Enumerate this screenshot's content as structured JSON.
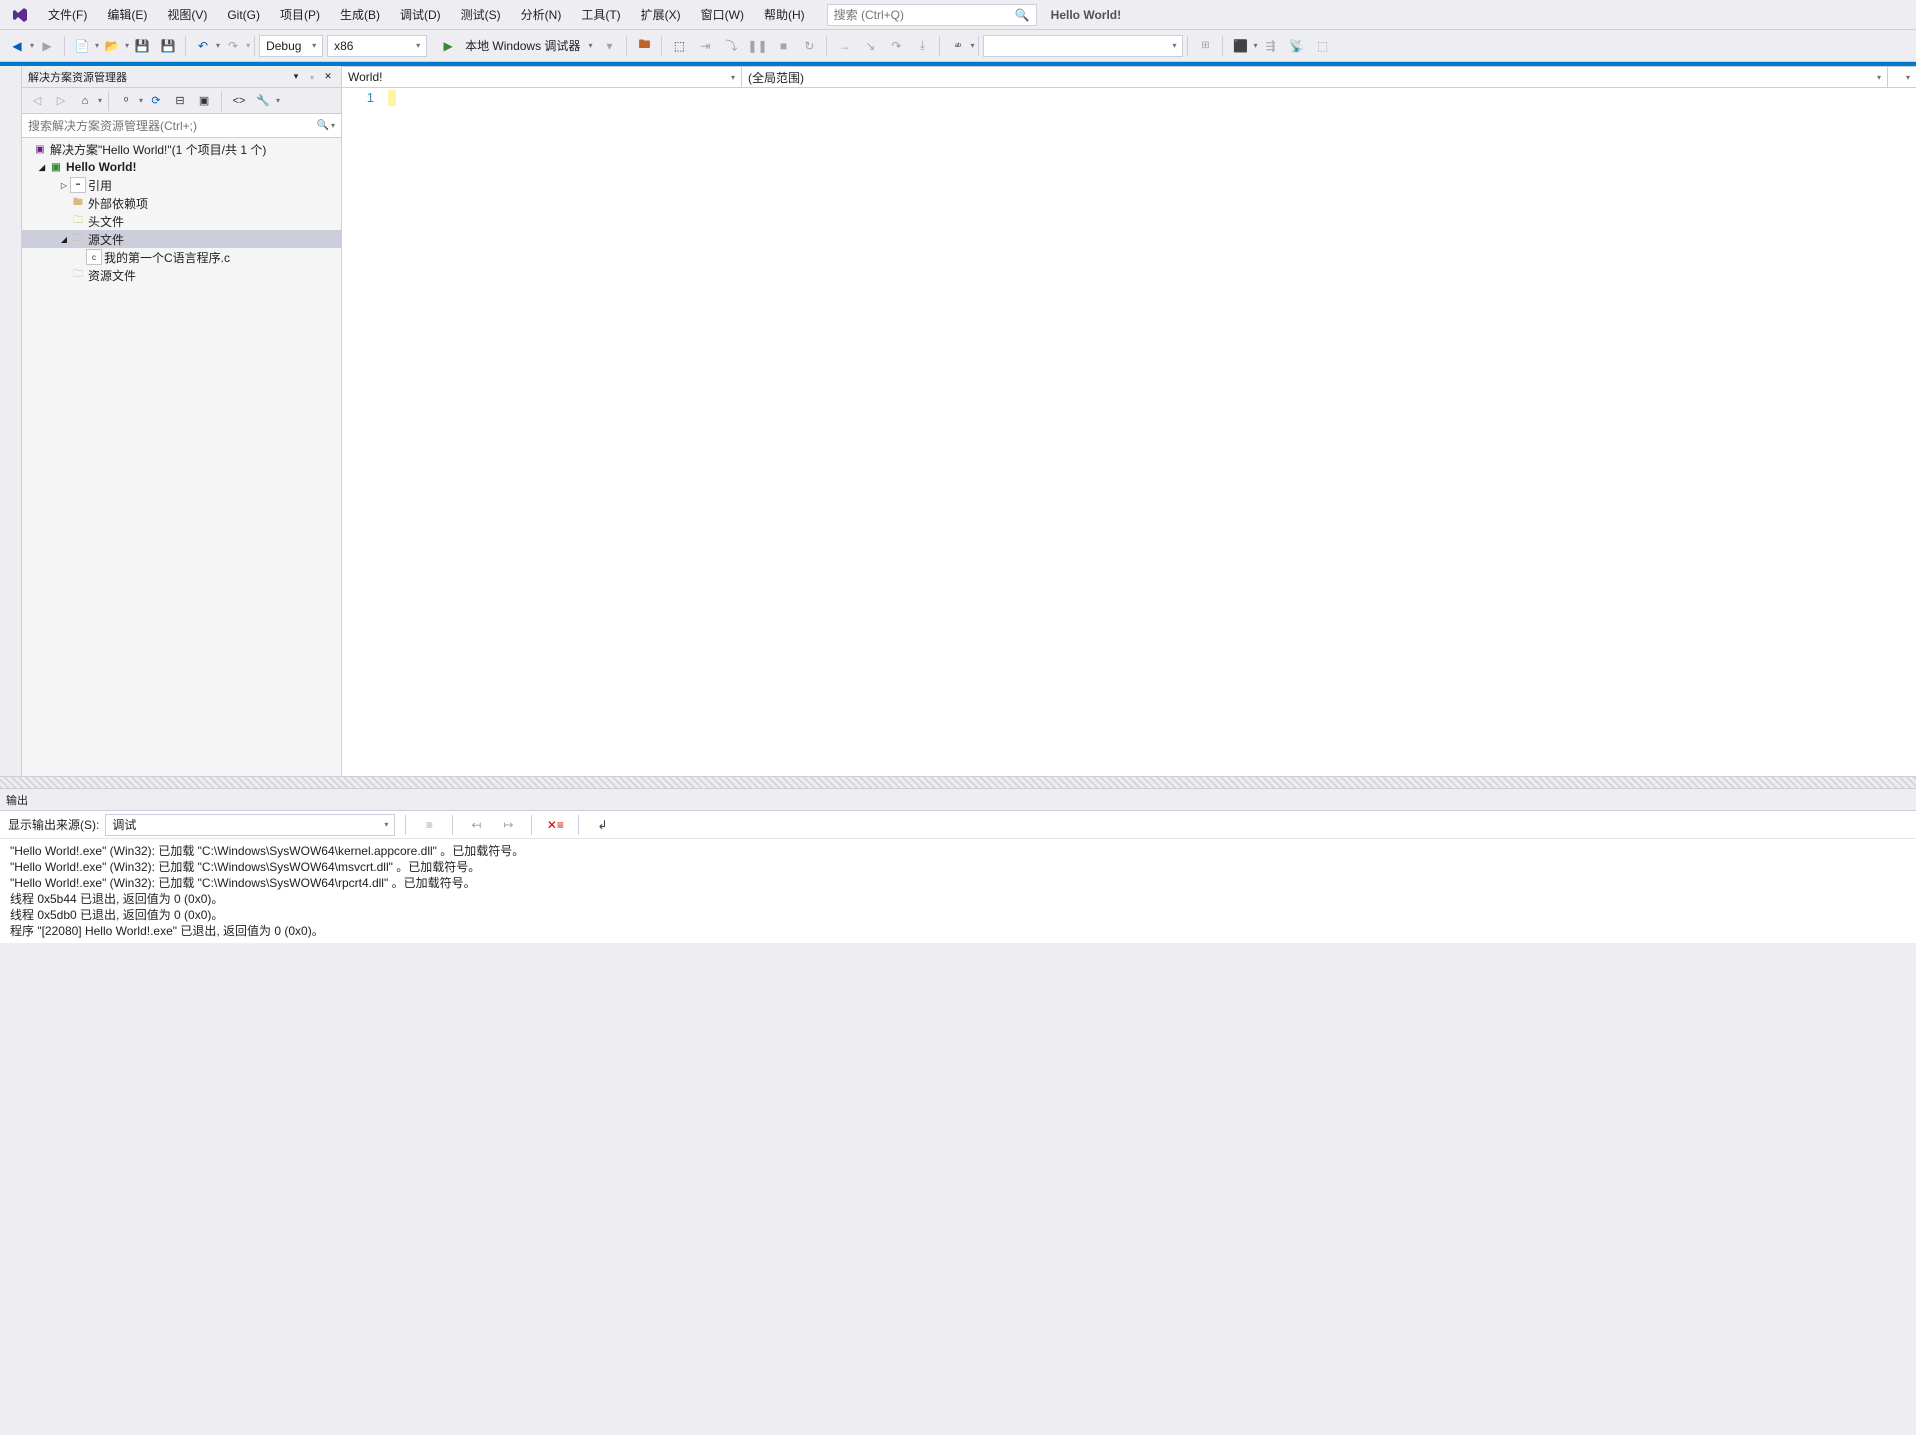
{
  "app": {
    "title": "Hello World!"
  },
  "menu": {
    "file": "文件(F)",
    "edit": "编辑(E)",
    "view": "视图(V)",
    "git": "Git(G)",
    "project": "项目(P)",
    "build": "生成(B)",
    "debug": "调试(D)",
    "test": "测试(S)",
    "analyze": "分析(N)",
    "tools": "工具(T)",
    "extensions": "扩展(X)",
    "window": "窗口(W)",
    "help": "帮助(H)"
  },
  "search": {
    "placeholder": "搜索 (Ctrl+Q)"
  },
  "toolbar": {
    "config": "Debug",
    "platform": "x86",
    "start_label": "本地 Windows 调试器"
  },
  "nav": {
    "left": "World!",
    "right": "(全局范围)"
  },
  "solution_explorer": {
    "title": "解决方案资源管理器",
    "search_placeholder": "搜索解决方案资源管理器(Ctrl+;)",
    "solution_label": "解决方案\"Hello World!\"(1 个项目/共 1 个)",
    "project": "Hello World!",
    "references": "引用",
    "external": "外部依赖项",
    "headers": "头文件",
    "sources": "源文件",
    "source_file": "我的第一个C语言程序.c",
    "resources": "资源文件"
  },
  "editor": {
    "line1": "1"
  },
  "output": {
    "title": "输出",
    "source_label": "显示输出来源(S):",
    "source_value": "调试",
    "lines": [
      "\"Hello World!.exe\" (Win32): 已加载 \"C:\\Windows\\SysWOW64\\kernel.appcore.dll\" 。已加载符号。",
      "\"Hello World!.exe\" (Win32): 已加载 \"C:\\Windows\\SysWOW64\\msvcrt.dll\" 。已加载符号。",
      "\"Hello World!.exe\" (Win32): 已加载 \"C:\\Windows\\SysWOW64\\rpcrt4.dll\" 。已加载符号。",
      "线程 0x5b44 已退出, 返回值为 0 (0x0)。",
      "线程 0x5db0 已退出, 返回值为 0 (0x0)。",
      "程序 \"[22080] Hello World!.exe\" 已退出, 返回值为 0 (0x0)。"
    ]
  }
}
